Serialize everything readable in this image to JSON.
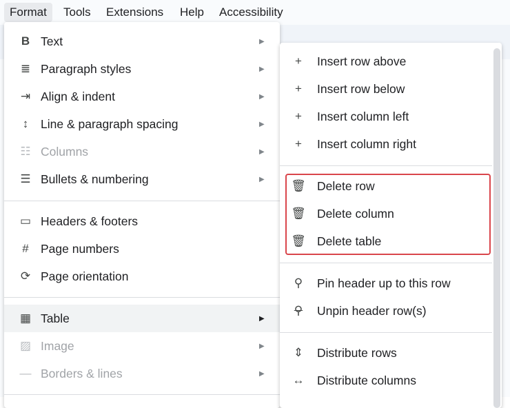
{
  "menubar": [
    "Format",
    "Tools",
    "Extensions",
    "Help",
    "Accessibility"
  ],
  "format_menu": {
    "items": [
      {
        "label": "Text",
        "icon": "bold-icon",
        "glyph": "B",
        "submenu": true,
        "disabled": false
      },
      {
        "label": "Paragraph styles",
        "icon": "paragraph-styles-icon",
        "glyph": "≣",
        "submenu": true,
        "disabled": false
      },
      {
        "label": "Align & indent",
        "icon": "align-indent-icon",
        "glyph": "⇥",
        "submenu": true,
        "disabled": false
      },
      {
        "label": "Line & paragraph spacing",
        "icon": "line-spacing-icon",
        "glyph": "↕",
        "submenu": true,
        "disabled": false
      },
      {
        "label": "Columns",
        "icon": "columns-icon",
        "glyph": "☷",
        "submenu": true,
        "disabled": true
      },
      {
        "label": "Bullets & numbering",
        "icon": "bullets-icon",
        "glyph": "☰",
        "submenu": true,
        "disabled": false
      },
      {
        "label": "Headers & footers",
        "icon": "headers-footers-icon",
        "glyph": "▭",
        "submenu": false,
        "disabled": false
      },
      {
        "label": "Page numbers",
        "icon": "hash-icon",
        "glyph": "#",
        "submenu": false,
        "disabled": false
      },
      {
        "label": "Page orientation",
        "icon": "page-orientation-icon",
        "glyph": "⟳",
        "submenu": false,
        "disabled": false
      },
      {
        "label": "Table",
        "icon": "table-icon",
        "glyph": "▦",
        "submenu": true,
        "disabled": false,
        "highlighted": true
      },
      {
        "label": "Image",
        "icon": "image-icon",
        "glyph": "▨",
        "submenu": true,
        "disabled": true
      },
      {
        "label": "Borders & lines",
        "icon": "borders-lines-icon",
        "glyph": "—",
        "submenu": true,
        "disabled": true
      }
    ]
  },
  "table_submenu": {
    "items": [
      {
        "label": "Insert row above",
        "icon": "plus-icon",
        "glyph": "+"
      },
      {
        "label": "Insert row below",
        "icon": "plus-icon",
        "glyph": "+"
      },
      {
        "label": "Insert column left",
        "icon": "plus-icon",
        "glyph": "+"
      },
      {
        "label": "Insert column right",
        "icon": "plus-icon",
        "glyph": "+"
      },
      {
        "label": "Delete row",
        "icon": "trash-icon",
        "glyph": "🗑"
      },
      {
        "label": "Delete column",
        "icon": "trash-icon",
        "glyph": "🗑"
      },
      {
        "label": "Delete table",
        "icon": "trash-icon",
        "glyph": "🗑"
      },
      {
        "label": "Pin header up to this row",
        "icon": "pin-icon",
        "glyph": "⚲"
      },
      {
        "label": "Unpin header row(s)",
        "icon": "unpin-icon",
        "glyph": "⚲"
      },
      {
        "label": "Distribute rows",
        "icon": "distribute-rows-icon",
        "glyph": "⇕"
      },
      {
        "label": "Distribute columns",
        "icon": "distribute-columns-icon",
        "glyph": "↔"
      }
    ]
  },
  "highlight_color": "#d9454b"
}
